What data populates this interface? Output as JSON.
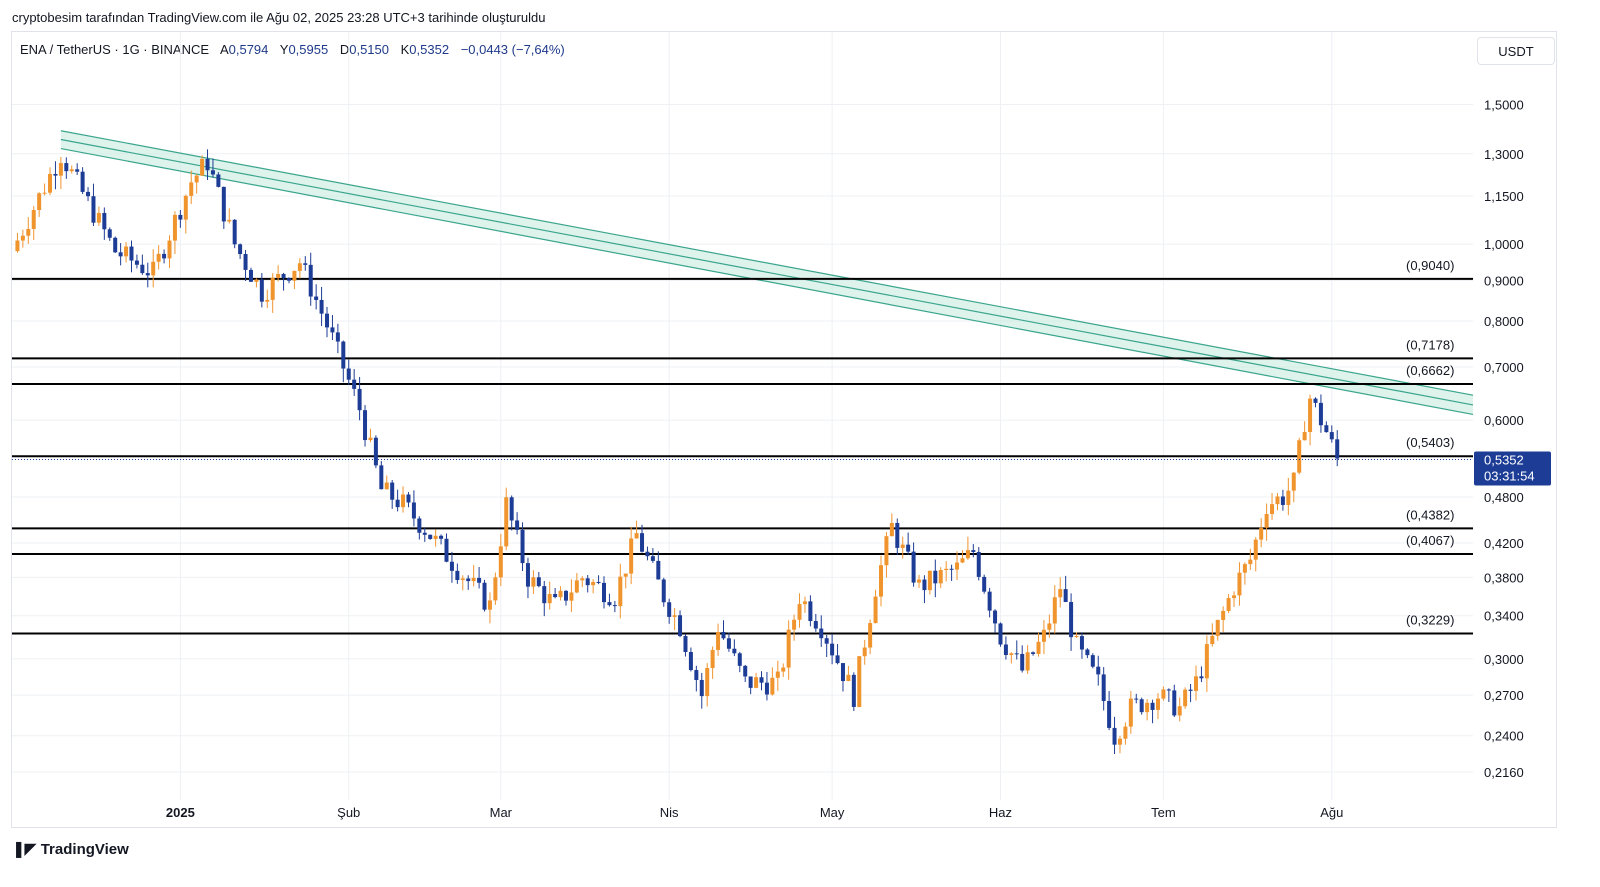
{
  "header": {
    "caption": "cryptobesim tarafından TradingView.com ile Ağu 02, 2025 23:28 UTC+3 tarihinde oluşturuldu"
  },
  "legend": {
    "symbol": "ENA / TetherUS · 1G · BINANCE",
    "open_label": "A",
    "open_value": "0,5794",
    "high_label": "Y",
    "high_value": "0,5955",
    "low_label": "D",
    "low_value": "0,5150",
    "close_label": "K",
    "close_value": "0,5352",
    "change": "−0,0443 (−7,64%)"
  },
  "currency_button": "USDT",
  "brand": {
    "name": "TradingView"
  },
  "colors": {
    "up": "#f0942e",
    "down": "#1d3c95",
    "channel_stroke": "#3aa58c",
    "channel_fill": "#cfeee4",
    "level_line": "#000000",
    "price_label_bg": "#1d3c95",
    "grid": "#eef0f4"
  },
  "chart_data": {
    "type": "candlestick",
    "scale": "log",
    "ylim": [
      0.205,
      1.62
    ],
    "y_ticks": [
      {
        "value": 1.5,
        "label": "1,5000"
      },
      {
        "value": 1.3,
        "label": "1,3000"
      },
      {
        "value": 1.15,
        "label": "1,1500"
      },
      {
        "value": 1.0,
        "label": "1,0000"
      },
      {
        "value": 0.9,
        "label": "0,9000"
      },
      {
        "value": 0.8,
        "label": "0,8000"
      },
      {
        "value": 0.7,
        "label": "0,7000"
      },
      {
        "value": 0.6,
        "label": "0,6000"
      },
      {
        "value": 0.48,
        "label": "0,4800"
      },
      {
        "value": 0.42,
        "label": "0,4200"
      },
      {
        "value": 0.38,
        "label": "0,3800"
      },
      {
        "value": 0.34,
        "label": "0,3400"
      },
      {
        "value": 0.3,
        "label": "0,3000"
      },
      {
        "value": 0.27,
        "label": "0,2700"
      },
      {
        "value": 0.24,
        "label": "0,2400"
      },
      {
        "value": 0.216,
        "label": "0,2160"
      }
    ],
    "x_ticks": [
      {
        "date": "2025-01-01",
        "label": "2025",
        "bold": true
      },
      {
        "date": "2025-02-01",
        "label": "Şub"
      },
      {
        "date": "2025-03-01",
        "label": "Mar"
      },
      {
        "date": "2025-04-01",
        "label": "Nis"
      },
      {
        "date": "2025-05-01",
        "label": "May"
      },
      {
        "date": "2025-06-01",
        "label": "Haz"
      },
      {
        "date": "2025-07-01",
        "label": "Tem"
      },
      {
        "date": "2025-08-01",
        "label": "Ağu"
      }
    ],
    "xlim": [
      "2024-12-01",
      "2025-08-27"
    ],
    "levels": [
      {
        "value": 0.904,
        "label": "(0,9040)"
      },
      {
        "value": 0.7178,
        "label": "(0,7178)"
      },
      {
        "value": 0.6662,
        "label": "(0,6662)"
      },
      {
        "value": 0.5403,
        "label": "(0,5403)"
      },
      {
        "value": 0.4382,
        "label": "(0,4382)"
      },
      {
        "value": 0.4067,
        "label": "(0,4067)"
      },
      {
        "value": 0.3229,
        "label": "(0,3229)"
      }
    ],
    "last_price": {
      "value": 0.5352,
      "label": "0,5352",
      "countdown": "03:31:54"
    },
    "channel": {
      "start_date": "2024-12-10",
      "end_date": "2025-08-27",
      "upper": [
        1.39,
        0.645
      ],
      "middle": [
        1.355,
        0.627
      ],
      "lower": [
        1.32,
        0.61
      ]
    },
    "anchor_points": [
      [
        "2024-12-01",
        0.98
      ],
      [
        "2024-12-10",
        1.3
      ],
      [
        "2024-12-14",
        1.16
      ],
      [
        "2024-12-20",
        0.98
      ],
      [
        "2024-12-27",
        0.92
      ],
      [
        "2025-01-03",
        1.2
      ],
      [
        "2025-01-06",
        1.27
      ],
      [
        "2025-01-11",
        1.0
      ],
      [
        "2025-01-16",
        0.87
      ],
      [
        "2025-01-23",
        0.95
      ],
      [
        "2025-01-28",
        0.79
      ],
      [
        "2025-02-03",
        0.62
      ],
      [
        "2025-02-07",
        0.49
      ],
      [
        "2025-02-11",
        0.47
      ],
      [
        "2025-02-16",
        0.43
      ],
      [
        "2025-02-21",
        0.39
      ],
      [
        "2025-02-27",
        0.35
      ],
      [
        "2025-03-02",
        0.47
      ],
      [
        "2025-03-06",
        0.38
      ],
      [
        "2025-03-11",
        0.35
      ],
      [
        "2025-03-16",
        0.38
      ],
      [
        "2025-03-22",
        0.36
      ],
      [
        "2025-03-26",
        0.43
      ],
      [
        "2025-03-31",
        0.36
      ],
      [
        "2025-04-03",
        0.33
      ],
      [
        "2025-04-07",
        0.27
      ],
      [
        "2025-04-10",
        0.33
      ],
      [
        "2025-04-15",
        0.28
      ],
      [
        "2025-04-21",
        0.28
      ],
      [
        "2025-04-25",
        0.36
      ],
      [
        "2025-04-29",
        0.33
      ],
      [
        "2025-05-05",
        0.27
      ],
      [
        "2025-05-09",
        0.37
      ],
      [
        "2025-05-12",
        0.44
      ],
      [
        "2025-05-17",
        0.37
      ],
      [
        "2025-05-24",
        0.39
      ],
      [
        "2025-05-27",
        0.41
      ],
      [
        "2025-06-01",
        0.32
      ],
      [
        "2025-06-05",
        0.29
      ],
      [
        "2025-06-09",
        0.32
      ],
      [
        "2025-06-12",
        0.37
      ],
      [
        "2025-06-15",
        0.31
      ],
      [
        "2025-06-19",
        0.28
      ],
      [
        "2025-06-22",
        0.24
      ],
      [
        "2025-06-25",
        0.26
      ],
      [
        "2025-06-30",
        0.27
      ],
      [
        "2025-07-04",
        0.26
      ],
      [
        "2025-07-07",
        0.28
      ],
      [
        "2025-07-11",
        0.33
      ],
      [
        "2025-07-14",
        0.37
      ],
      [
        "2025-07-17",
        0.4
      ],
      [
        "2025-07-20",
        0.47
      ],
      [
        "2025-07-23",
        0.48
      ],
      [
        "2025-07-25",
        0.5
      ],
      [
        "2025-07-27",
        0.6
      ],
      [
        "2025-07-28",
        0.64
      ],
      [
        "2025-07-30",
        0.6
      ],
      [
        "2025-07-31",
        0.58
      ],
      [
        "2025-08-02",
        0.535
      ]
    ]
  }
}
